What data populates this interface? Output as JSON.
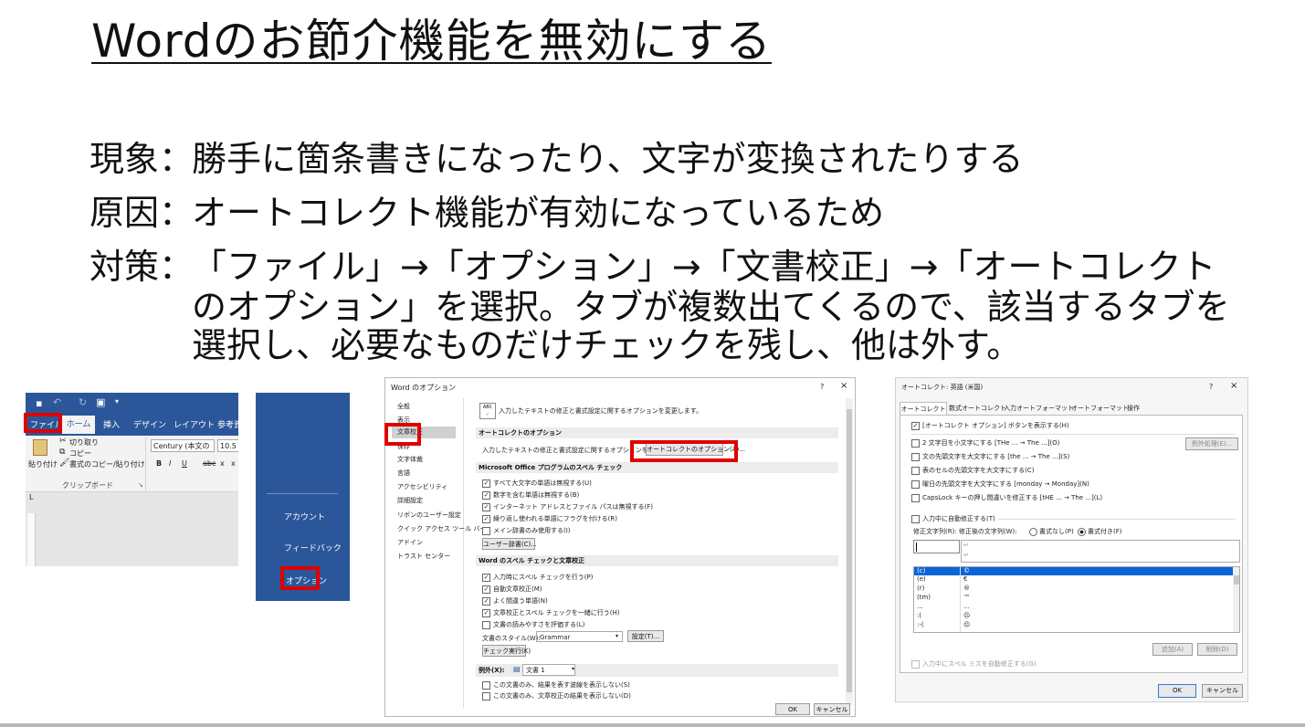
{
  "title": "Wordのお節介機能を無効にする",
  "bullets": [
    {
      "label": "現象：",
      "lines": [
        "勝手に箇条書きになったり、文字が変換されたりする"
      ]
    },
    {
      "label": "原因：",
      "lines": [
        "オートコレクト機能が有効になっているため"
      ]
    },
    {
      "label": "対策：",
      "lines": [
        "「ファイル」→「オプション」→「文書校正」→「オートコレクト",
        "のオプション」を選択。タブが複数出てくるので、該当するタブを",
        "選択し、必要なものだけチェックを残し、他は外す。"
      ]
    }
  ],
  "ribbon": {
    "tabs": [
      "ファイル",
      "ホーム",
      "挿入",
      "デザイン",
      "レイアウト",
      "参考資"
    ],
    "paste": "貼り付け",
    "cut": "切り取り",
    "copy": "コピー",
    "format_copy": "書式のコピー/貼り付け",
    "clipboard": "クリップボード",
    "font": "Century (本文の",
    "size": "10.5",
    "buttons": [
      "B",
      "I",
      "U",
      "abc",
      "x",
      "x"
    ]
  },
  "backstage": {
    "items": [
      "アカウント",
      "フィードバック",
      "オプション"
    ]
  },
  "options_dialog": {
    "title": "Word のオプション",
    "help": "?",
    "close": "×",
    "nav": [
      "全般",
      "表示",
      "文章校正",
      "保存",
      "文字体裁",
      "言語",
      "アクセシビリティ",
      "詳細設定",
      "リボンのユーザー設定",
      "クイック アクセス ツール バー",
      "アドイン",
      "トラスト センター"
    ],
    "header_text": "入力したテキストの修正と書式設定に関するオプションを変更します。",
    "abc": "ABC",
    "sec1": "オートコレクトのオプション",
    "sec1_text": "入力したテキストの修正と書式設定に関するオプションを変更します。",
    "autocorrect_button": "オートコレクトのオプション(A)...",
    "sec2": "Microsoft Office プログラムのスペル チェック",
    "sec2_items": [
      "すべて大文字の単語は無視する(U)",
      "数字を含む単語は無視する(B)",
      "インターネット アドレスとファイル パスは無視する(F)",
      "繰り返し使われる単語にフラグを付ける(R)",
      "メイン辞書のみ使用する(I)"
    ],
    "sec2_checked": [
      true,
      true,
      true,
      true,
      false
    ],
    "user_dict": "ユーザー辞書(C)...",
    "sec3": "Word のスペル チェックと文章校正",
    "sec3_items": [
      "入力時にスペル チェックを行う(P)",
      "自動文章校正(M)",
      "よく間違う単語(N)",
      "文章校正とスペル チェックを一緒に行う(H)",
      "文書の読みやすさを評価する(L)"
    ],
    "sec3_checked": [
      true,
      true,
      true,
      true,
      false
    ],
    "style_label": "文書のスタイル(W):",
    "style_value": "Grammar",
    "settings": "設定(T)...",
    "recheck": "チェック実行(K)",
    "exceptions_label": "例外(X):",
    "exceptions_value": "文書 1",
    "ex_items": [
      "この文書のみ、結果を表す波線を表示しない(S)",
      "この文書のみ、文章校正の結果を表示しない(D)"
    ],
    "ok": "OK",
    "cancel": "キャンセル"
  },
  "autocorrect_dialog": {
    "title": "オートコレクト: 英語 (米国)",
    "help": "?",
    "close": "×",
    "tabs": [
      "オートコレクト",
      "数式オートコレクト",
      "入力オートフォーマット",
      "オートフォーマット",
      "操作"
    ],
    "show_buttons": "[オートコレクト オプション] ボタンを表示する(H)",
    "items": [
      "2 文字目を小文字にする [THe ... → The ...](O)",
      "文の先頭文字を大文字にする [the ... → The ...](S)",
      "表のセルの先頭文字を大文字にする(C)",
      "曜日の先頭文字を大文字にする [monday → Monday](N)",
      "CapsLock キーの押し間違いを修正する [tHE ... → The ...](L)"
    ],
    "exceptions": "例外処理(E)...",
    "replace_label": "入力中に自動修正する(T)",
    "columns_label": "修正文字列(R): 修正後の文字列(W):",
    "plain": "書式なし(P)",
    "formatted": "書式付き(F)",
    "replace_arrow": "↵",
    "rows": [
      [
        "(c)",
        "©"
      ],
      [
        "(e)",
        "€"
      ],
      [
        "(r)",
        "®"
      ],
      [
        "(tm)",
        "™"
      ],
      [
        "...",
        "…"
      ],
      [
        ":(",
        "☹"
      ],
      [
        ":-(",
        "☹"
      ]
    ],
    "add": "追加(A)",
    "delete": "削除(D)",
    "spell_fix": "入力中にスペル ミスを自動修正する(G)",
    "ok": "OK",
    "cancel": "キャンセル"
  }
}
